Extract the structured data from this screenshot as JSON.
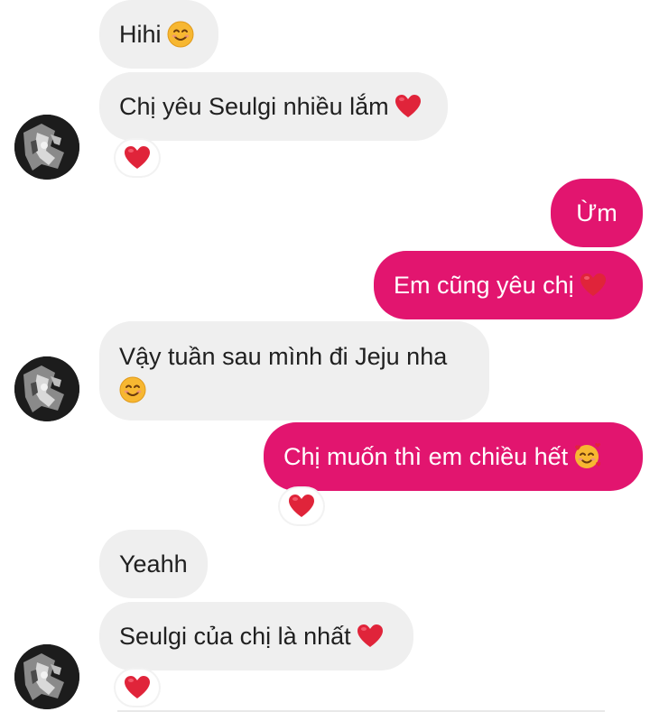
{
  "messages": [
    {
      "text": "Hihi",
      "emoji": "smiling-face-icon"
    },
    {
      "text": "Chị yêu Seulgi nhiều lắm",
      "emoji": "red-heart-icon"
    },
    {
      "text": "Ừm"
    },
    {
      "text": "Em cũng yêu chị",
      "emoji": "red-heart-icon"
    },
    {
      "text": "Vậy tuần sau mình đi Jeju nha",
      "emoji": "smiling-face-icon"
    },
    {
      "text": "Chị muốn thì em chiều hết",
      "emoji": "smiling-face-with-hearts-icon"
    },
    {
      "text": "Yeahh"
    },
    {
      "text": "Seulgi của chị là nhất",
      "emoji": "red-heart-icon"
    }
  ],
  "reactions": [
    "red-heart-icon",
    "red-heart-icon",
    "red-heart-icon"
  ],
  "colors": {
    "incoming_bubble": "#efefef",
    "outgoing_bubble": "#e2156f",
    "heart": "#e0243a",
    "emoji_yellow": "#f7b731"
  }
}
